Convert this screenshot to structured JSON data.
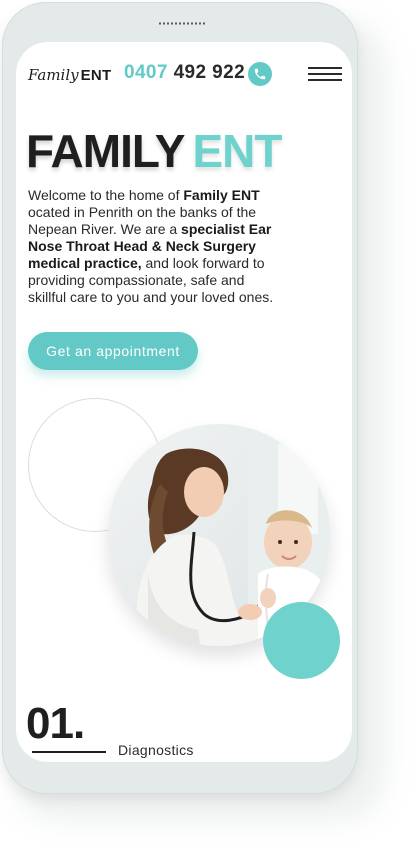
{
  "header": {
    "logo_script": "Family",
    "logo_bold": "ENT",
    "phone_prefix": "0407",
    "phone_rest": "492 922"
  },
  "hero": {
    "title_dark": "FAMILY",
    "title_accent": "ENT",
    "intro_1": "Welcome to the home of ",
    "intro_bold_1": "Family ENT",
    "intro_2": " ocated in Penrith on the banks of the Nepean River. We are a ",
    "intro_bold_2": "specialist Ear Nose Throat Head & Neck Surgery medical practice,",
    "intro_3": " and look forward to providing compassionate, safe and skillful care to you and your loved ones.",
    "cta_label": "Get an appointment"
  },
  "services": {
    "step_number": "01.",
    "step_label": "Diagnostics"
  },
  "colors": {
    "accent": "#63c9c6",
    "text": "#1f1f1f"
  }
}
